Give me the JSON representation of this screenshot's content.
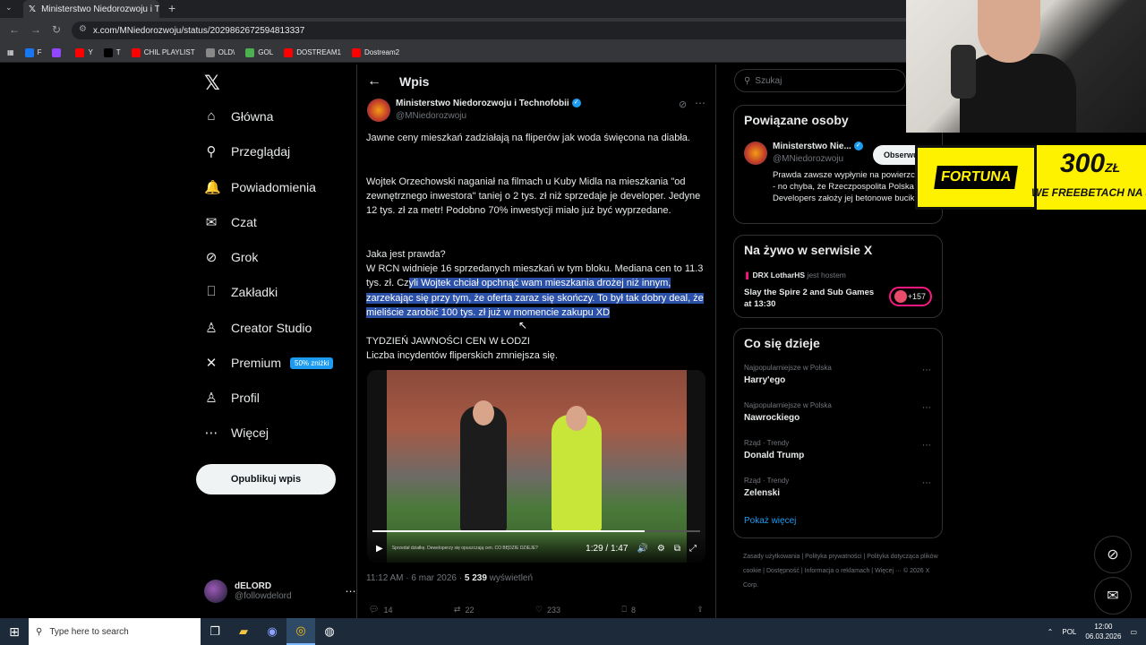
{
  "browser": {
    "tab_title": "Ministerstwo Niedorozwoju i Te",
    "url": "x.com/MNiedorozwoju/status/2029862672594813337",
    "bookmarks": [
      {
        "label": "F",
        "color": "#1877f2"
      },
      {
        "label": "",
        "color": "#9146ff"
      },
      {
        "label": "Y",
        "color": "#ff0000"
      },
      {
        "label": "T",
        "color": "#000000"
      },
      {
        "label": "CHIL PLAYLIST",
        "color": "#ff0000"
      },
      {
        "label": "OLD\\",
        "color": "#888888"
      },
      {
        "label": "GOL",
        "color": "#4caf50"
      },
      {
        "label": "DOSTREAM1",
        "color": "#ff0000"
      },
      {
        "label": "Dostream2",
        "color": "#ff0000"
      }
    ]
  },
  "sidebar": {
    "items": [
      {
        "label": "Główna",
        "icon": "home-icon",
        "glyph": "⌂"
      },
      {
        "label": "Przeglądaj",
        "icon": "search-icon",
        "glyph": "⚲"
      },
      {
        "label": "Powiadomienia",
        "icon": "bell-icon",
        "glyph": "🔔"
      },
      {
        "label": "Czat",
        "icon": "mail-icon",
        "glyph": "✉"
      },
      {
        "label": "Grok",
        "icon": "grok-icon",
        "glyph": "⊘"
      },
      {
        "label": "Zakładki",
        "icon": "bookmark-icon",
        "glyph": "⎕"
      },
      {
        "label": "Creator Studio",
        "icon": "creator-icon",
        "glyph": "♙"
      },
      {
        "label": "Premium",
        "icon": "x-icon",
        "glyph": "✕"
      },
      {
        "label": "Profil",
        "icon": "user-icon",
        "glyph": "♙"
      },
      {
        "label": "Więcej",
        "icon": "more-icon",
        "glyph": "⋯"
      }
    ],
    "premium_badge": "50% zniżki",
    "publish_label": "Opublikuj wpis",
    "account": {
      "name": "dELORD",
      "handle": "@followdelord"
    }
  },
  "post": {
    "header_title": "Wpis",
    "author_name": "Ministerstwo Niedorozwoju i Technofobii",
    "author_handle": "@MNiedorozwoju",
    "p1": "Jawne ceny mieszkań zadziałają na fliperów jak woda święcona na diabła.",
    "p2": "Wojtek Orzechowski naganiał na filmach u Kuby Midla na mieszkania \"od zewnętrznego inwestora\" taniej o 2 tys. zł niż sprzedaje je developer. Jedyne 12 tys. zł za metr! Podobno 70% inwestycji miało już być wyprzedane.",
    "p3_heading": "Jaka jest prawda?",
    "p3_plain": "W RCN widnieje 16 sprzedanych mieszkań w tym bloku. Mediana cen to 11.3 tys. zł. Cz",
    "p3_highlight": "yli Wojtek chciał opchnąć wam mieszkania drożej niż innym, zarzekając się przy tym, że oferta zaraz się skończy. To był tak dobry deal, że mieliście zarobić 100 tys. zł już w momencie zakupu XD",
    "p4_line1": "TYDZIEŃ JAWNOŚCI CEN W ŁODZI",
    "p4_line2": "Liczba incydentów fliperskich zmniejsza się.",
    "video": {
      "time": "1:29 / 1:47",
      "progress": 0.83,
      "caption": "Sprzedał działkę. Deweloperzy się opuszczają cen. CO BĘDZIE DZIEJE?"
    },
    "meta_time": "11:12 AM · 6 mar 2026 · ",
    "views": "5 239",
    "views_label": " wyświetleń",
    "replies": "14",
    "reposts": "22",
    "likes": "233",
    "bookmarks": "8"
  },
  "right": {
    "search_placeholder": "Szukaj",
    "related_title": "Powiązane osoby",
    "related": {
      "name": "Ministerstwo Nie...",
      "handle": "@MNiedorozwoju",
      "bio": "Prawda zawsze wypłynie na powierzchnię - no chyba, że Rzeczpospolita Polska Developers założy jej betonowe bucikI.",
      "follow_label": "Obserwuj"
    },
    "live_title": "Na żywo w serwisie X",
    "live": {
      "host": "DRX LotharHS",
      "host_suffix": " jest hostem",
      "title": "Slay the Spire 2 and Sub Games at 13:30",
      "count": "+157"
    },
    "trends_title": "Co się dzieje",
    "trends": [
      {
        "category": "Najpopularniejsze w Polska",
        "name": "Harry'ego"
      },
      {
        "category": "Najpopularniejsze w Polska",
        "name": "Nawrockiego"
      },
      {
        "category": "Rząd · Trendy",
        "name": "Donald Trump"
      },
      {
        "category": "Rząd · Trendy",
        "name": "Zelenski"
      }
    ],
    "show_more": "Pokaż więcej",
    "footer": "Zasady użytkowania  |  Polityka prywatności  |  Polityka dotycząca plików cookie  |  Dostępność  |  Informacja o reklamach  |  Więcej ···  © 2026 X Corp."
  },
  "ad": {
    "brand": "FORTUNA",
    "amount": "300",
    "currency": "ZŁ",
    "sub": "WE FREEBETACH NA STA"
  },
  "taskbar": {
    "search_placeholder": "Type here to search",
    "lang": "POL",
    "time": "12:00",
    "date": "06.03.2026"
  }
}
